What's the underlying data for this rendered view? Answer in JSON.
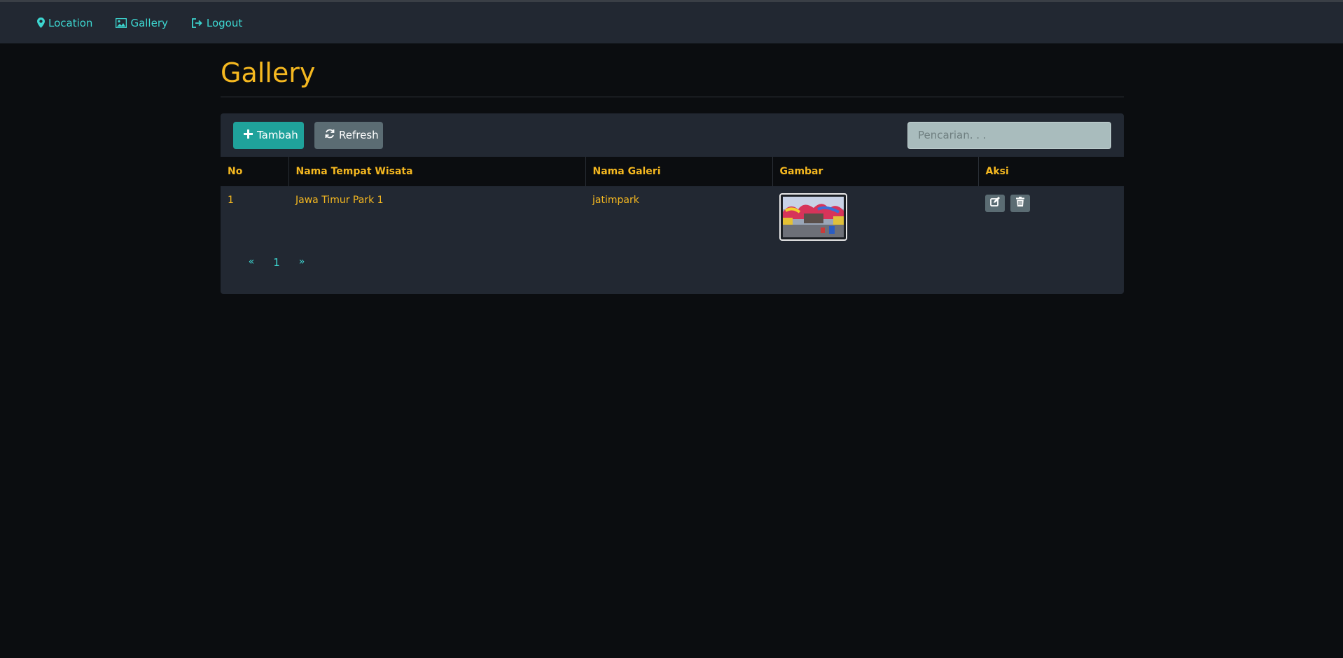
{
  "nav": {
    "items": [
      {
        "label": "Location",
        "icon": "map-marker-icon"
      },
      {
        "label": "Gallery",
        "icon": "image-icon"
      },
      {
        "label": "Logout",
        "icon": "logout-icon"
      }
    ]
  },
  "page": {
    "title": "Gallery"
  },
  "toolbar": {
    "add_label": "Tambah",
    "refresh_label": "Refresh",
    "search_placeholder": "Pencarian. . ."
  },
  "table": {
    "headers": [
      "No",
      "Nama Tempat Wisata",
      "Nama Galeri",
      "Gambar",
      "Aksi"
    ],
    "rows": [
      {
        "no": "1",
        "tempat": "Jawa Timur Park 1",
        "galeri": "jatimpark"
      }
    ]
  },
  "pagination": {
    "prev": "«",
    "current": "1",
    "next": "»"
  },
  "colors": {
    "accent": "#f5b820",
    "link": "#3dd6d0",
    "add_button": "#1fa29b",
    "secondary_button": "#5b6c73",
    "navbar": "#222832",
    "background": "#0b0d10"
  }
}
